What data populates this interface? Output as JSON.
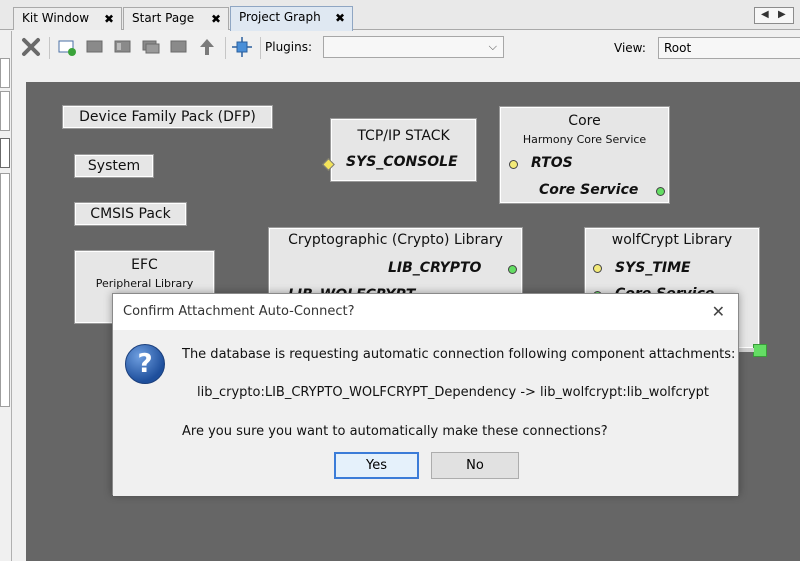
{
  "tabs": [
    {
      "label": "Kit Window",
      "close": "✖"
    },
    {
      "label": "Start Page",
      "close": "✖"
    },
    {
      "label": "Project Graph",
      "close": "✖"
    }
  ],
  "toolbar": {
    "plugins_label": "Plugins:",
    "plugins_value": "",
    "view_label": "View:",
    "view_value": "Root"
  },
  "graph": {
    "dfp": "Device Family Pack (DFP)",
    "system": "System",
    "cmsis": "CMSIS Pack",
    "efc_title": "EFC",
    "efc_sub": "Peripheral Library",
    "tcpip_title": "TCP/IP STACK",
    "tcpip_dep": "SYS_CONSOLE",
    "core_title": "Core",
    "core_sub": "Harmony Core Service",
    "core_dep1": "RTOS",
    "core_dep2": "Core Service",
    "crypto_title": "Cryptographic (Crypto) Library",
    "crypto_dep1": "LIB_CRYPTO",
    "crypto_dep2": "LIB_WOLFCRYPT",
    "wolf_title": "wolfCrypt Library",
    "wolf_dep1": "SYS_TIME",
    "wolf_dep2": "Core Service"
  },
  "dialog": {
    "title": "Confirm Attachment Auto-Connect?",
    "line1": "The database is requesting automatic connection following component attachments:",
    "line2": "lib_crypto:LIB_CRYPTO_WOLFCRYPT_Dependency -> lib_wolfcrypt:lib_wolfcrypt",
    "line3": "Are you sure you want to automatically make these connections?",
    "yes": "Yes",
    "no": "No",
    "close": "✕",
    "icon": "?"
  }
}
